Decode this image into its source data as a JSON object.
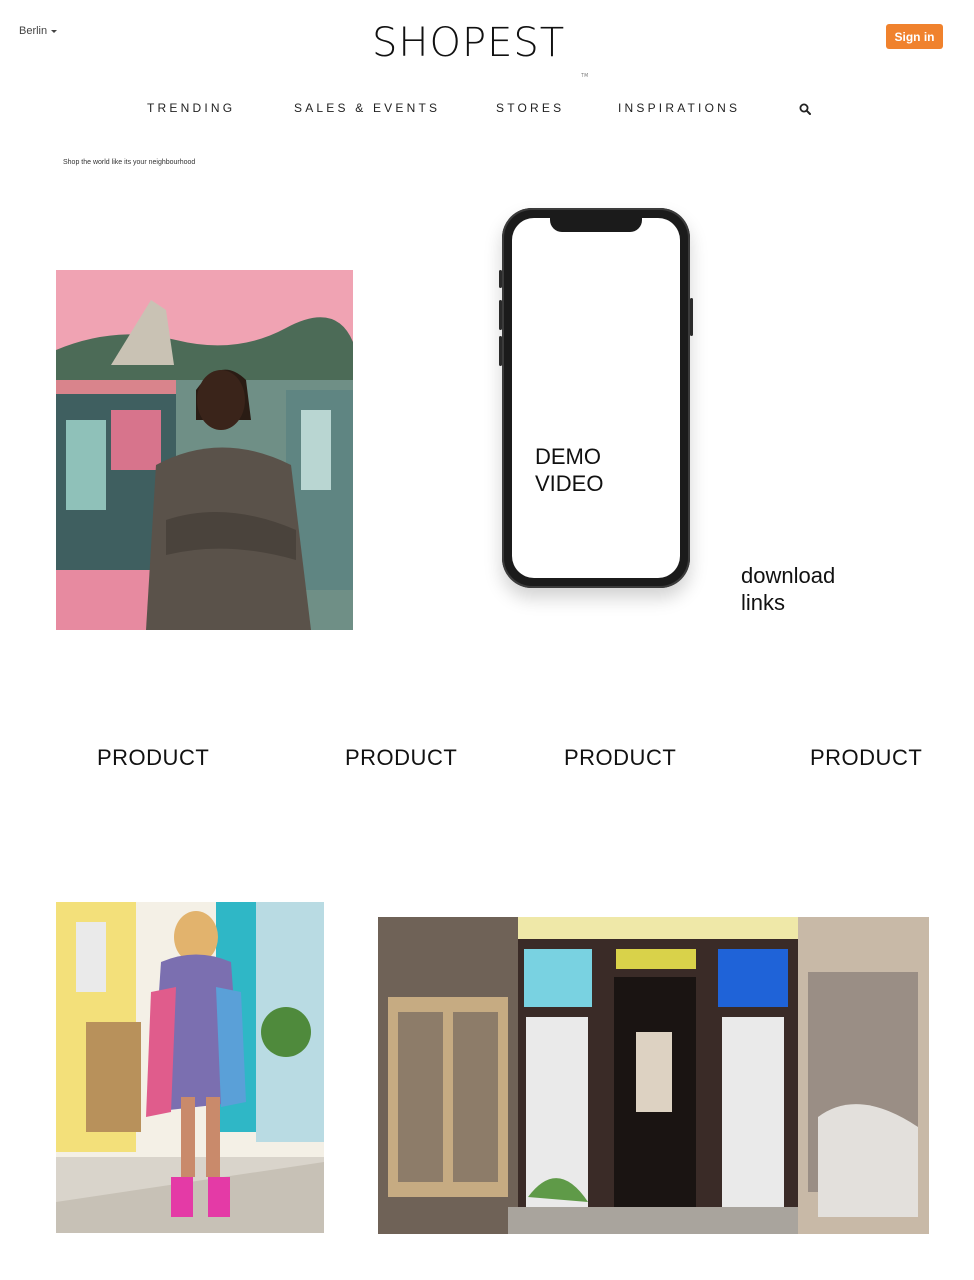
{
  "header": {
    "city": "Berlin",
    "logo": "SHOPEST",
    "logo_tm": "TM",
    "sign_in": "Sign in"
  },
  "nav": {
    "items": [
      "TRENDING",
      "SALES & EVENTS",
      "STORES",
      "INSPIRATIONS"
    ],
    "search_icon": "search-icon"
  },
  "hero": {
    "tagline": "Shop the world like its your neighbourhood",
    "demo_video": "DEMO\nVIDEO",
    "download_links": "download\nlinks"
  },
  "products": [
    "PRODUCT",
    "PRODUCT",
    "PRODUCT",
    "PRODUCT"
  ],
  "colors": {
    "accent": "#f0822d",
    "text": "#111111",
    "background": "#ffffff"
  }
}
